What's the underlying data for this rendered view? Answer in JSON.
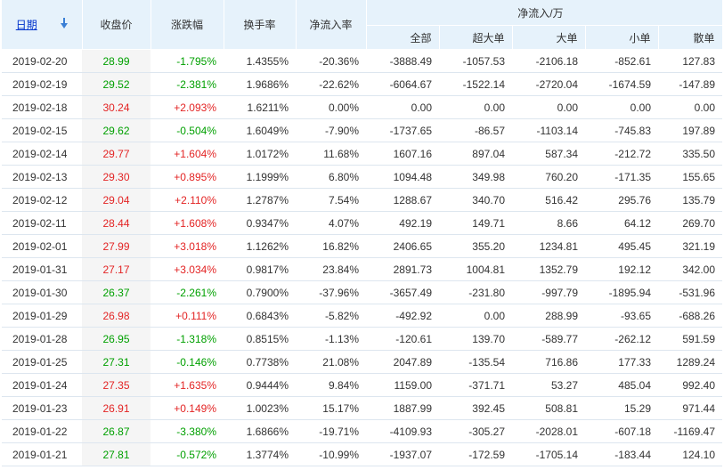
{
  "header": {
    "date": "日期",
    "close": "收盘价",
    "change": "涨跌幅",
    "turnover": "换手率",
    "net_rate": "净流入率",
    "net_group": "净流入/万",
    "sub": [
      "全部",
      "超大单",
      "大单",
      "小单",
      "散单"
    ]
  },
  "colors": {
    "up": "#e32424",
    "down": "#00a000",
    "header_bg": "#e6f2fb",
    "link": "#0033cc"
  },
  "rows": [
    {
      "date": "2019-02-20",
      "close": "28.99",
      "change": "-1.795%",
      "turnover": "1.4355%",
      "rate": "-20.36%",
      "all": "-3888.49",
      "xl": "-1057.53",
      "l": "-2106.18",
      "s": "-852.61",
      "r": "127.83",
      "dir": "down"
    },
    {
      "date": "2019-02-19",
      "close": "29.52",
      "change": "-2.381%",
      "turnover": "1.9686%",
      "rate": "-22.62%",
      "all": "-6064.67",
      "xl": "-1522.14",
      "l": "-2720.04",
      "s": "-1674.59",
      "r": "-147.89",
      "dir": "down"
    },
    {
      "date": "2019-02-18",
      "close": "30.24",
      "change": "+2.093%",
      "turnover": "1.6211%",
      "rate": "0.00%",
      "all": "0.00",
      "xl": "0.00",
      "l": "0.00",
      "s": "0.00",
      "r": "0.00",
      "dir": "up"
    },
    {
      "date": "2019-02-15",
      "close": "29.62",
      "change": "-0.504%",
      "turnover": "1.6049%",
      "rate": "-7.90%",
      "all": "-1737.65",
      "xl": "-86.57",
      "l": "-1103.14",
      "s": "-745.83",
      "r": "197.89",
      "dir": "down"
    },
    {
      "date": "2019-02-14",
      "close": "29.77",
      "change": "+1.604%",
      "turnover": "1.0172%",
      "rate": "11.68%",
      "all": "1607.16",
      "xl": "897.04",
      "l": "587.34",
      "s": "-212.72",
      "r": "335.50",
      "dir": "up"
    },
    {
      "date": "2019-02-13",
      "close": "29.30",
      "change": "+0.895%",
      "turnover": "1.1999%",
      "rate": "6.80%",
      "all": "1094.48",
      "xl": "349.98",
      "l": "760.20",
      "s": "-171.35",
      "r": "155.65",
      "dir": "up"
    },
    {
      "date": "2019-02-12",
      "close": "29.04",
      "change": "+2.110%",
      "turnover": "1.2787%",
      "rate": "7.54%",
      "all": "1288.67",
      "xl": "340.70",
      "l": "516.42",
      "s": "295.76",
      "r": "135.79",
      "dir": "up"
    },
    {
      "date": "2019-02-11",
      "close": "28.44",
      "change": "+1.608%",
      "turnover": "0.9347%",
      "rate": "4.07%",
      "all": "492.19",
      "xl": "149.71",
      "l": "8.66",
      "s": "64.12",
      "r": "269.70",
      "dir": "up"
    },
    {
      "date": "2019-02-01",
      "close": "27.99",
      "change": "+3.018%",
      "turnover": "1.1262%",
      "rate": "16.82%",
      "all": "2406.65",
      "xl": "355.20",
      "l": "1234.81",
      "s": "495.45",
      "r": "321.19",
      "dir": "up"
    },
    {
      "date": "2019-01-31",
      "close": "27.17",
      "change": "+3.034%",
      "turnover": "0.9817%",
      "rate": "23.84%",
      "all": "2891.73",
      "xl": "1004.81",
      "l": "1352.79",
      "s": "192.12",
      "r": "342.00",
      "dir": "up"
    },
    {
      "date": "2019-01-30",
      "close": "26.37",
      "change": "-2.261%",
      "turnover": "0.7900%",
      "rate": "-37.96%",
      "all": "-3657.49",
      "xl": "-231.80",
      "l": "-997.79",
      "s": "-1895.94",
      "r": "-531.96",
      "dir": "down"
    },
    {
      "date": "2019-01-29",
      "close": "26.98",
      "change": "+0.111%",
      "turnover": "0.6843%",
      "rate": "-5.82%",
      "all": "-492.92",
      "xl": "0.00",
      "l": "288.99",
      "s": "-93.65",
      "r": "-688.26",
      "dir": "up"
    },
    {
      "date": "2019-01-28",
      "close": "26.95",
      "change": "-1.318%",
      "turnover": "0.8515%",
      "rate": "-1.13%",
      "all": "-120.61",
      "xl": "139.70",
      "l": "-589.77",
      "s": "-262.12",
      "r": "591.59",
      "dir": "down"
    },
    {
      "date": "2019-01-25",
      "close": "27.31",
      "change": "-0.146%",
      "turnover": "0.7738%",
      "rate": "21.08%",
      "all": "2047.89",
      "xl": "-135.54",
      "l": "716.86",
      "s": "177.33",
      "r": "1289.24",
      "dir": "down"
    },
    {
      "date": "2019-01-24",
      "close": "27.35",
      "change": "+1.635%",
      "turnover": "0.9444%",
      "rate": "9.84%",
      "all": "1159.00",
      "xl": "-371.71",
      "l": "53.27",
      "s": "485.04",
      "r": "992.40",
      "dir": "up"
    },
    {
      "date": "2019-01-23",
      "close": "26.91",
      "change": "+0.149%",
      "turnover": "1.0023%",
      "rate": "15.17%",
      "all": "1887.99",
      "xl": "392.45",
      "l": "508.81",
      "s": "15.29",
      "r": "971.44",
      "dir": "up"
    },
    {
      "date": "2019-01-22",
      "close": "26.87",
      "change": "-3.380%",
      "turnover": "1.6866%",
      "rate": "-19.71%",
      "all": "-4109.93",
      "xl": "-305.27",
      "l": "-2028.01",
      "s": "-607.18",
      "r": "-1169.47",
      "dir": "down"
    },
    {
      "date": "2019-01-21",
      "close": "27.81",
      "change": "-0.572%",
      "turnover": "1.3774%",
      "rate": "-10.99%",
      "all": "-1937.07",
      "xl": "-172.59",
      "l": "-1705.14",
      "s": "-183.44",
      "r": "124.10",
      "dir": "down"
    }
  ]
}
